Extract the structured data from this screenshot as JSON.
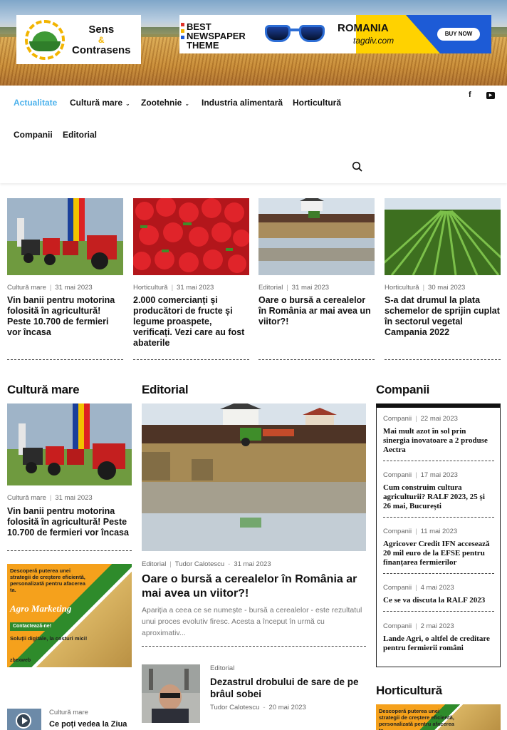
{
  "header": {
    "logo": {
      "line1": "Sens",
      "amp": "&",
      "line2": "Contrasens"
    },
    "ad": {
      "line1": "BEST",
      "line2": "NEWSPAPER",
      "line3": "THEME",
      "romania": "ROMANIA",
      "tagdiv": "tagdiv.com",
      "buy": "BUY NOW"
    }
  },
  "nav": {
    "items": [
      {
        "label": "Actualitate",
        "active": true
      },
      {
        "label": "Cultură mare",
        "has_dropdown": true
      },
      {
        "label": "Zootehnie",
        "has_dropdown": true
      },
      {
        "label": "Industria alimentară"
      },
      {
        "label": "Horticultură"
      },
      {
        "label": "Companii"
      },
      {
        "label": "Editorial"
      }
    ],
    "social": [
      "facebook-icon",
      "youtube-icon"
    ],
    "search_icon": "search-icon",
    "facebook_glyph": "f",
    "youtube_glyph": "▶"
  },
  "top_cards": [
    {
      "category": "Cultură mare",
      "date": "31 mai 2023",
      "title": "Vin banii pentru motorina folosită în agricultură! Peste 10.700 de fermieri vor încasa"
    },
    {
      "category": "Horticultură",
      "date": "31 mai 2023",
      "title": "2.000 comercianți și producători de fructe și legume proaspete, verificați. Vezi care au fost abaterile"
    },
    {
      "category": "Editorial",
      "date": "31 mai 2023",
      "title": "Oare o bursă a cerealelor în România ar mai avea un viitor?!"
    },
    {
      "category": "Horticultură",
      "date": "30 mai 2023",
      "title": "S-a dat drumul la plata schemelor de sprijin cuplat în sectorul vegetal Campania 2022"
    }
  ],
  "sections": {
    "cultura_mare": {
      "title": "Cultură mare",
      "article": {
        "category": "Cultură mare",
        "date": "31 mai 2023",
        "title": "Vin banii pentru motorina folosită în agricultură! Peste 10.700 de fermieri vor încasa"
      },
      "ad": {
        "text": "Descoperă puterea unei strategii de creștere eficientă, personalizată pentru afacerea ta.",
        "brand": "Agro Marketing",
        "button": "Contactează-ne!",
        "sub": "Soluții digitale, la costuri mici!",
        "company": "zbexweb"
      },
      "small_article": {
        "category": "Cultură mare",
        "title": "Ce poți vedea la Ziua"
      }
    },
    "editorial": {
      "title": "Editorial",
      "main": {
        "category": "Editorial",
        "author": "Tudor Calotescu",
        "date": "31 mai 2023",
        "title": "Oare o bursă a cerealelor în România ar mai avea un viitor?!",
        "excerpt": "Apariția a ceea ce se numește - bursă a cerealelor - este rezultatul unui proces evolutiv firesc. Acesta a început în urmă cu aproximativ..."
      },
      "second": {
        "category": "Editorial",
        "title": "Dezastrul drobului de sare de pe brâul sobei",
        "author": "Tudor Calotescu",
        "date": "20 mai 2023"
      }
    },
    "companii": {
      "title": "Companii",
      "items": [
        {
          "category": "Companii",
          "date": "22 mai 2023",
          "title": "Mai mult azot în sol prin sinergia inovatoare a 2 produse Aectra"
        },
        {
          "category": "Companii",
          "date": "17 mai 2023",
          "title": "Cum construim cultura agriculturii? RALF 2023, 25 și 26 mai, București"
        },
        {
          "category": "Companii",
          "date": "11 mai 2023",
          "title": "Agricover Credit IFN accesează 20 mil euro de la EFSE pentru finanțarea fermierilor"
        },
        {
          "category": "Companii",
          "date": "4 mai 2023",
          "title": "Ce se va discuta la RALF 2023"
        },
        {
          "category": "Companii",
          "date": "2 mai 2023",
          "title": "Lande Agri, o altfel de creditare pentru fermierii români"
        }
      ]
    },
    "horticultura": {
      "title": "Horticultură",
      "ad_text": "Descoperă puterea unei strategii de creștere eficientă, personalizată pentru afacerea ta."
    }
  }
}
